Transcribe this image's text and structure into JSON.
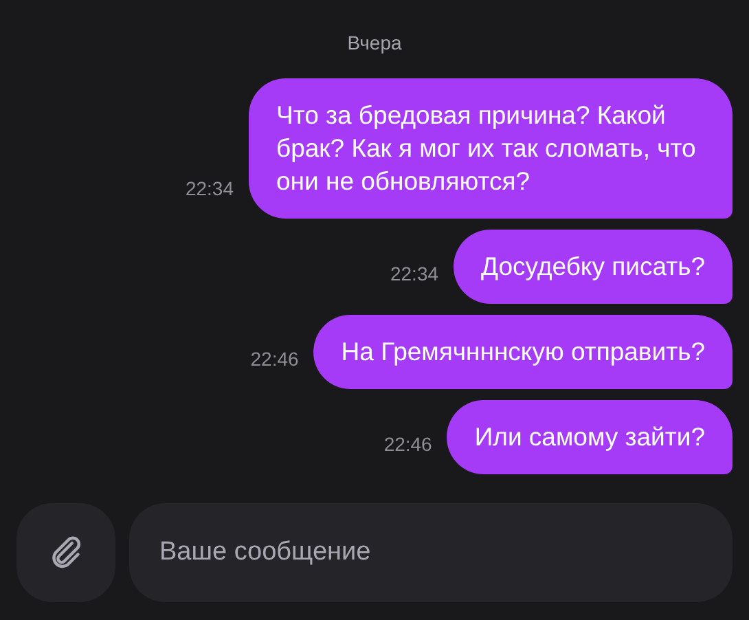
{
  "date_separator": "Вчера",
  "messages": [
    {
      "text": "Что за бредовая причина? Какой брак? Как я мог их так сломать, что они не обновляются?",
      "time": "22:34"
    },
    {
      "text": "Досудебку писать?",
      "time": "22:34"
    },
    {
      "text": "На Гремячнннскую отправить?",
      "time": "22:46"
    },
    {
      "text": "Или самому зайти?",
      "time": "22:46"
    }
  ],
  "composer": {
    "placeholder": "Ваше сообщение"
  }
}
